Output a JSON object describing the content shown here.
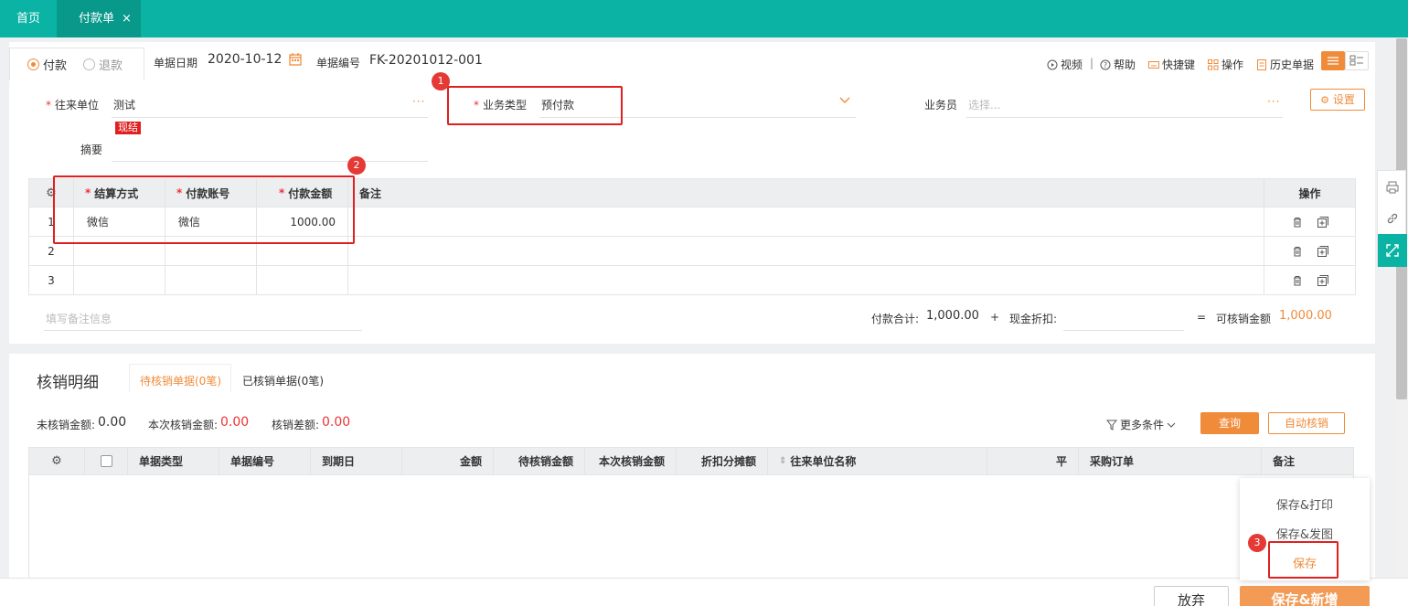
{
  "tabs": {
    "home": "首页",
    "active": "付款单",
    "close": "×"
  },
  "header": {
    "radio_pay": "付款",
    "radio_refund": "退款",
    "date_label": "单据日期",
    "date_value": "2020-10-12",
    "no_label": "单据编号",
    "no_value": "FK-20201012-001"
  },
  "toolbar": {
    "video": "视频",
    "sep": "|",
    "help": "帮助",
    "shortcut": "快捷键",
    "operate": "操作",
    "history": "历史单据"
  },
  "form": {
    "partner_label": "往来单位",
    "partner_value": "测试",
    "partner_more": "···",
    "cash_tag": "现结",
    "biz_type_label": "业务类型",
    "biz_type_value": "预付款",
    "salesman_label": "业务员",
    "salesman_placeholder": "选择...",
    "salesman_more": "···",
    "settings_button": "设置",
    "summary_label": "摘要",
    "req_mark": "*"
  },
  "badges": {
    "b1": "1",
    "b2": "2",
    "b3": "3"
  },
  "pay_table": {
    "columns": [
      "结算方式",
      "付款账号",
      "付款金额",
      "备注",
      "操作"
    ],
    "rows": [
      {
        "no": "1",
        "method": "微信",
        "account": "微信",
        "amount": "1000.00",
        "remark": ""
      },
      {
        "no": "2",
        "method": "",
        "account": "",
        "amount": "",
        "remark": ""
      },
      {
        "no": "3",
        "method": "",
        "account": "",
        "amount": "",
        "remark": ""
      }
    ]
  },
  "totals": {
    "remark_placeholder": "填写备注信息",
    "pay_total_label": "付款合计:",
    "pay_total_value": "1,000.00",
    "plus": "+",
    "discount_label": "现金折扣:",
    "equals": "=",
    "writeoff_label": "可核销金额",
    "writeoff_value": "1,000.00"
  },
  "writeoff": {
    "title": "核销明细",
    "tab_pending": "待核销单据(0笔)",
    "tab_done": "已核销单据(0笔)",
    "unwritten_label": "未核销金额:",
    "unwritten_value": "0.00",
    "current_label": "本次核销金额:",
    "current_value": "0.00",
    "diff_label": "核销差额:",
    "diff_value": "0.00",
    "more_conditions": "更多条件",
    "query_button": "查询",
    "auto_button": "自动核销",
    "columns": [
      "单据类型",
      "单据编号",
      "到期日",
      "金额",
      "待核销金额",
      "本次核销金额",
      "折扣分摊额",
      "往来单位名称",
      "平",
      "采购订单",
      "备注"
    ]
  },
  "save_menu": {
    "save_print": "保存&打印",
    "save_send": "保存&发图",
    "save": "保存"
  },
  "footer": {
    "discard": "放弃",
    "save_new": "保存&新增"
  },
  "colors": {
    "brand": "#0ab3a3",
    "accent": "#f08b3a",
    "danger": "#e02020"
  }
}
